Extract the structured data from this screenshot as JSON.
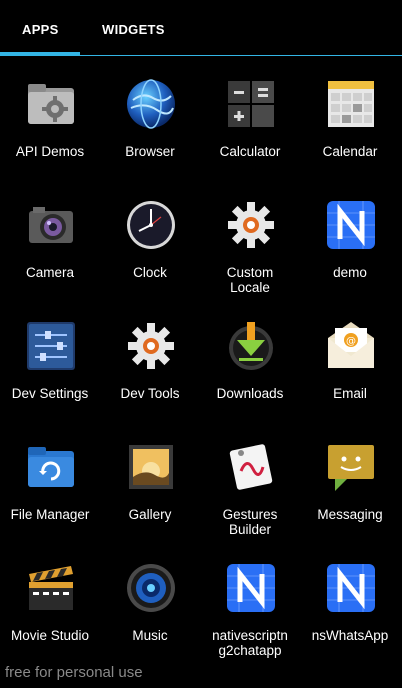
{
  "tabs": {
    "apps": "APPS",
    "widgets": "WIDGETS"
  },
  "apps": [
    {
      "label": "API Demos",
      "icon": "folder-gear-icon"
    },
    {
      "label": "Browser",
      "icon": "globe-icon"
    },
    {
      "label": "Calculator",
      "icon": "calculator-icon"
    },
    {
      "label": "Calendar",
      "icon": "calendar-icon"
    },
    {
      "label": "Camera",
      "icon": "camera-icon"
    },
    {
      "label": "Clock",
      "icon": "clock-icon"
    },
    {
      "label": "Custom\nLocale",
      "icon": "gear-icon"
    },
    {
      "label": "demo",
      "icon": "nativescript-icon"
    },
    {
      "label": "Dev Settings",
      "icon": "sliders-icon"
    },
    {
      "label": "Dev Tools",
      "icon": "gear-icon"
    },
    {
      "label": "Downloads",
      "icon": "download-icon"
    },
    {
      "label": "Email",
      "icon": "email-icon"
    },
    {
      "label": "File Manager",
      "icon": "folder-refresh-icon"
    },
    {
      "label": "Gallery",
      "icon": "gallery-icon"
    },
    {
      "label": "Gestures\nBuilder",
      "icon": "gestures-icon"
    },
    {
      "label": "Messaging",
      "icon": "messaging-icon"
    },
    {
      "label": "Movie Studio",
      "icon": "clapperboard-icon"
    },
    {
      "label": "Music",
      "icon": "speaker-icon"
    },
    {
      "label": "nativescriptn\ng2chatapp",
      "icon": "nativescript-icon"
    },
    {
      "label": "nsWhatsApp",
      "icon": "nativescript-icon"
    }
  ],
  "footer": "free for personal use",
  "colors": {
    "accent": "#33b5e5",
    "background": "#000000"
  }
}
